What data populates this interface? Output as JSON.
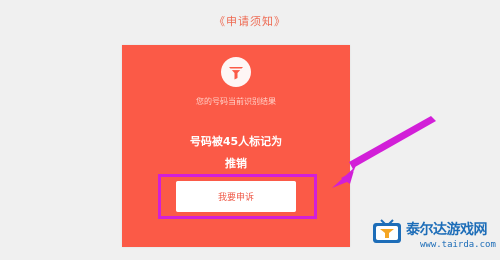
{
  "header": {
    "title": "《申请须知》"
  },
  "card": {
    "result_caption": "您的号码当前识别结果",
    "mark_count_text": "号码被45人标记为",
    "mark_tag": "推销",
    "appeal_button_label": "我要申诉",
    "logo_icon": "funnel-icon"
  },
  "overlay": {
    "arrow_icon": "pointer-arrow-icon",
    "highlight_color": "#d21fd8"
  },
  "watermark": {
    "name": "泰尔达游戏网",
    "url": "www.tairda.com",
    "logo_icon": "tv-logo-icon"
  },
  "colors": {
    "accent": "#fb5a47",
    "background": "#f0f0f0",
    "highlight": "#d21fd8",
    "watermark_blue": "#1d6db8"
  }
}
